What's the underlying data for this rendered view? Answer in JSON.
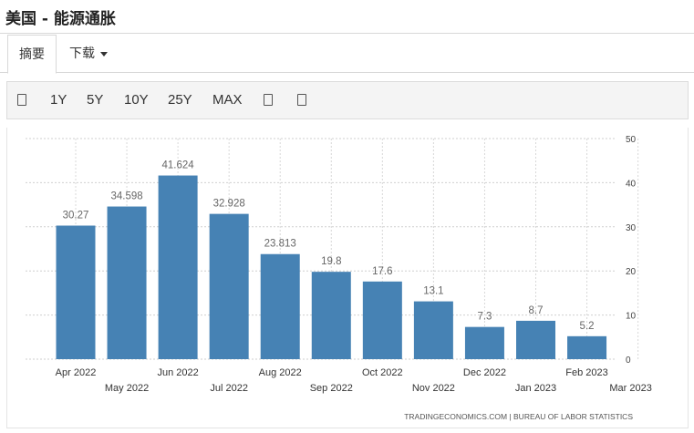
{
  "header": {
    "title": "美国 - 能源通胀"
  },
  "tabs": [
    {
      "label": "摘要"
    },
    {
      "label": "下载"
    }
  ],
  "toolbar": {
    "buttons": [
      "1Y",
      "5Y",
      "10Y",
      "25Y",
      "MAX"
    ],
    "icons": [
      "calendar-icon",
      "bar-chart-icon",
      "line-chart-icon"
    ]
  },
  "chart_data": {
    "type": "bar",
    "categories": [
      "Apr 2022",
      "May 2022",
      "Jun 2022",
      "Jul 2022",
      "Aug 2022",
      "Sep 2022",
      "Oct 2022",
      "Nov 2022",
      "Dec 2022",
      "Jan 2023",
      "Feb 2023"
    ],
    "values": [
      30.27,
      34.598,
      41.624,
      32.928,
      23.813,
      19.8,
      17.6,
      13.1,
      7.3,
      8.7,
      5.2
    ],
    "value_labels": [
      "30.27",
      "34.598",
      "41.624",
      "32.928",
      "23.813",
      "19.8",
      "17.6",
      "13.1",
      "7.3",
      "8.7",
      "5.2"
    ],
    "x_tick_labels": [
      "Apr 2022",
      "May 2022",
      "Jun 2022",
      "Jul 2022",
      "Aug 2022",
      "Sep 2022",
      "Oct 2022",
      "Nov 2022",
      "Dec 2022",
      "Jan 2023",
      "Feb 2023",
      "Mar 2023"
    ],
    "y_ticks": [
      "0",
      "10",
      "20",
      "30",
      "40",
      "50"
    ],
    "ylim": [
      0,
      50
    ],
    "y_axis_side": "right",
    "grid": true,
    "bar_color": "#4682b4",
    "source": "TRADINGECONOMICS.COM  |  BUREAU OF LABOR STATISTICS"
  }
}
